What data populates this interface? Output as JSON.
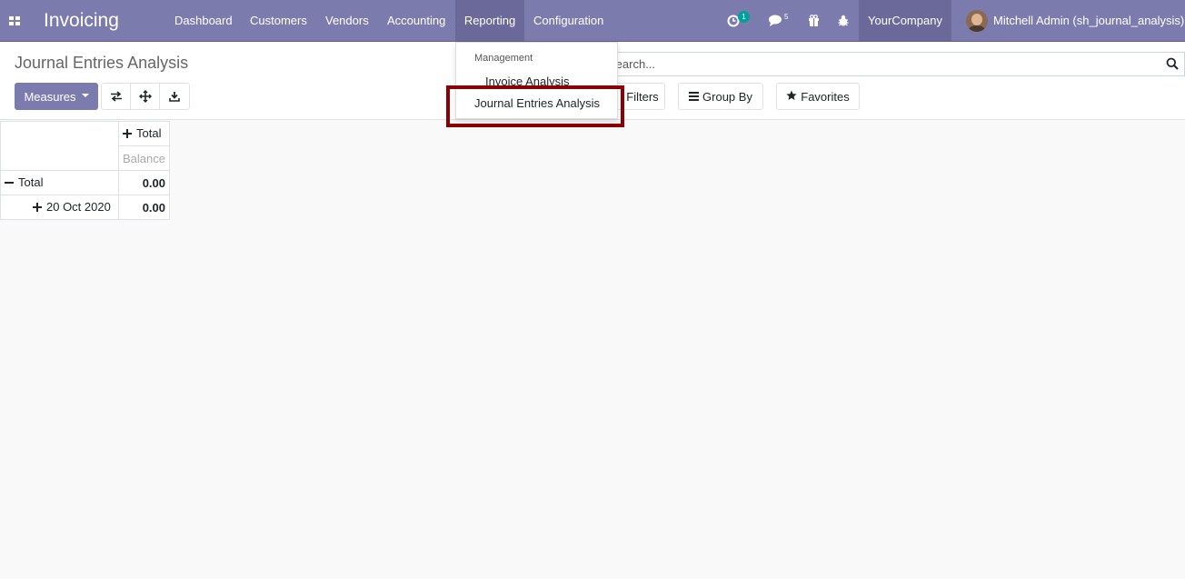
{
  "navbar": {
    "brand": "Invoicing",
    "menu": [
      "Dashboard",
      "Customers",
      "Vendors",
      "Accounting",
      "Reporting",
      "Configuration"
    ],
    "activity_count": "1",
    "messages_count": "5",
    "company": "YourCompany",
    "user": "Mitchell Admin (sh_journal_analysis)"
  },
  "control_panel": {
    "title": "Journal Entries Analysis",
    "measures_label": "Measures",
    "search_placeholder": "Search...",
    "filters_label": "Filters",
    "groupby_label": "Group By",
    "favorites_label": "Favorites"
  },
  "dropdown": {
    "header": "Management",
    "items": [
      "Invoice Analysis",
      "Journal Entries Analysis"
    ]
  },
  "pivot": {
    "col_header": "Total",
    "measure": "Balance",
    "rows": [
      {
        "label": "Total",
        "value": "0.00"
      },
      {
        "label": "20 Oct 2020",
        "value": "0.00"
      }
    ]
  },
  "colors": {
    "navbar": "#7c7bad",
    "highlight": "#8b0000"
  }
}
